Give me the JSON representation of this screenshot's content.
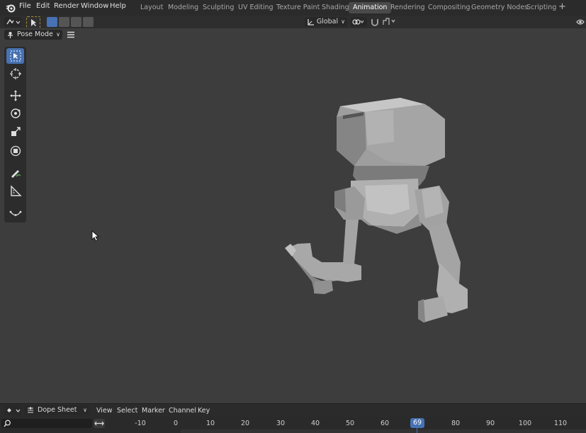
{
  "menu": {
    "items": [
      "File",
      "Edit",
      "Render",
      "Window",
      "Help"
    ]
  },
  "workspaces": {
    "tabs": [
      "Layout",
      "Modeling",
      "Sculpting",
      "UV Editing",
      "Texture Paint",
      "Shading",
      "Animation",
      "Rendering",
      "Compositing",
      "Geometry Nodes",
      "Scripting"
    ],
    "active": "Animation",
    "add_label": "+"
  },
  "viewport_header": {
    "transform_orientation": "Global",
    "mode": "Pose Mode"
  },
  "dope_sheet": {
    "editor_mode": "Dope Sheet",
    "menu": [
      "View",
      "Select",
      "Marker",
      "Channel",
      "Key"
    ]
  },
  "timeline": {
    "current_frame": "69",
    "ticks": [
      "-10",
      "0",
      "10",
      "20",
      "30",
      "40",
      "50",
      "60",
      "70",
      "80",
      "90",
      "100",
      "110"
    ]
  },
  "colors": {
    "accent": "#4772b3",
    "viewport_bg": "#3d3d3d"
  },
  "tools": [
    "select-box-icon",
    "cursor-icon",
    "move-icon",
    "rotate-icon",
    "scale-icon",
    "transform-icon",
    "annotate-icon",
    "measure-icon",
    "relax-pose-icon"
  ]
}
